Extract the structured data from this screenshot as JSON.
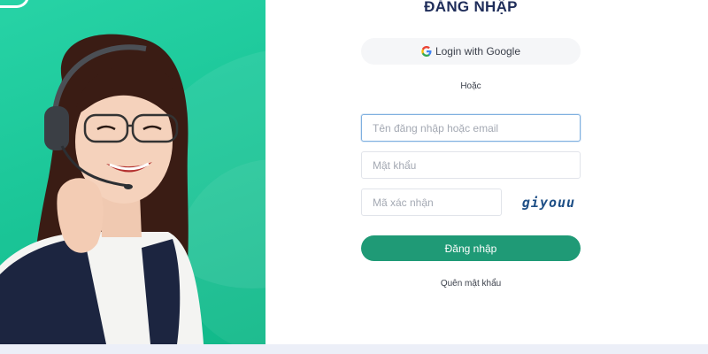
{
  "login": {
    "title": "ĐĂNG NHẬP",
    "google_label": "Login with Google",
    "or_text": "Hoặc",
    "username_placeholder": "Tên đăng nhập hoặc email",
    "password_placeholder": "Mật khẩu",
    "captcha_placeholder": "Mã xác nhận",
    "captcha_text": "giyouu",
    "submit_label": "Đăng nhập",
    "forgot_label": "Quên mật khẩu"
  },
  "colors": {
    "brand_green": "#1f9a76",
    "panel_green": "#1cc799",
    "heading_navy": "#1f2d5a"
  }
}
